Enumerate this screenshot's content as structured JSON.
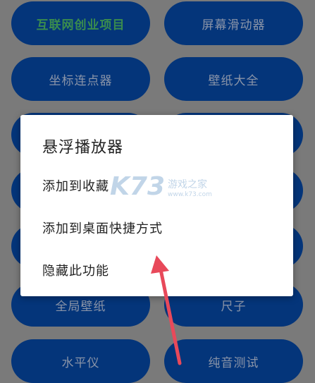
{
  "tiles": [
    {
      "label": "互联网创业项目"
    },
    {
      "label": "屏幕滑动器"
    },
    {
      "label": "坐标连点器"
    },
    {
      "label": "壁纸大全"
    },
    {
      "label": "全局壁纸"
    },
    {
      "label": "尺子"
    },
    {
      "label": "水平仪"
    },
    {
      "label": "纯音测试"
    }
  ],
  "dialog": {
    "title": "悬浮播放器",
    "items": [
      {
        "label": "添加到收藏"
      },
      {
        "label": "添加到桌面快捷方式"
      },
      {
        "label": "隐藏此功能"
      }
    ]
  },
  "watermark": {
    "logo": "K73",
    "site_name": "游戏之家",
    "url": "www.k73.com"
  },
  "colors": {
    "tile_bg": "#04357a",
    "tile_text": "#8a94a8",
    "accent_text": "#3a8c4e",
    "arrow": "#e8495a",
    "overlay": "#7a7a7a"
  }
}
